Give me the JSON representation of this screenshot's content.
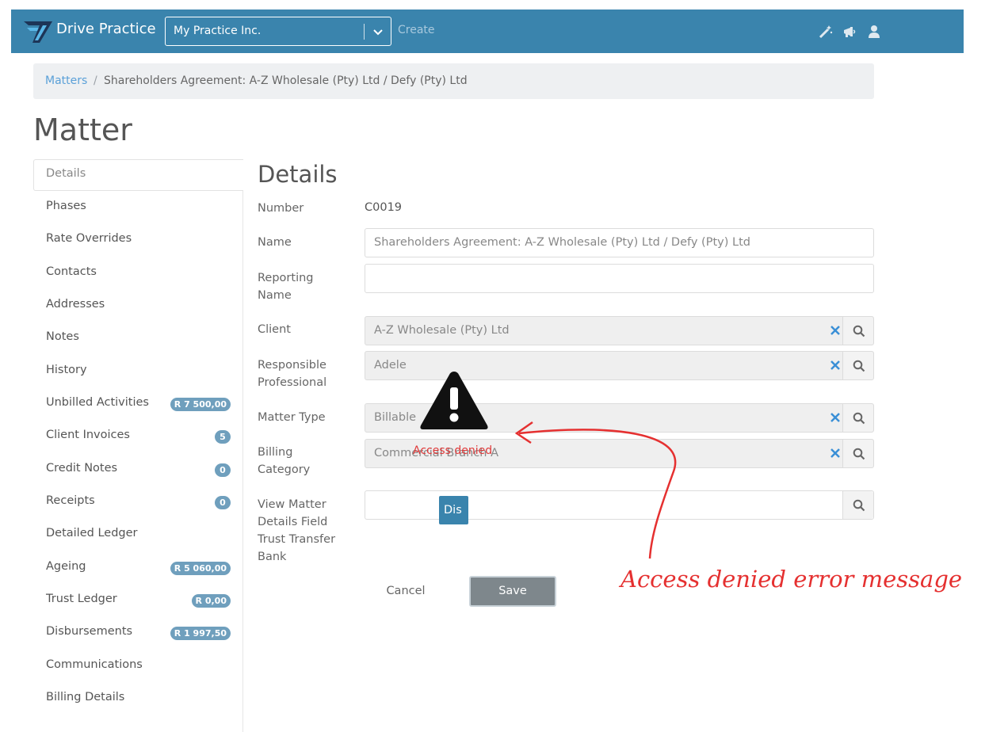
{
  "header": {
    "brand": "Drive Practice",
    "practice_selected": "My Practice Inc.",
    "create_label": "Create",
    "icons": [
      "magic-wand-icon",
      "megaphone-icon",
      "user-icon"
    ],
    "color": "#3a84ad"
  },
  "breadcrumb": {
    "link": "Matters",
    "separator": "/",
    "current": "Shareholders Agreement: A-Z Wholesale (Pty) Ltd / Defy (Pty) Ltd"
  },
  "page": {
    "title": "Matter"
  },
  "sidebar": {
    "items": [
      {
        "label": "Details",
        "active": true
      },
      {
        "label": "Phases"
      },
      {
        "label": "Rate Overrides"
      },
      {
        "label": "Contacts"
      },
      {
        "label": "Addresses"
      },
      {
        "label": "Notes"
      },
      {
        "label": "History"
      },
      {
        "label": "Unbilled Activities",
        "badge": "R 7 500,00"
      },
      {
        "label": "Client Invoices",
        "badge": "5"
      },
      {
        "label": "Credit Notes",
        "badge": "0"
      },
      {
        "label": "Receipts",
        "badge": "0"
      },
      {
        "label": "Detailed Ledger"
      },
      {
        "label": "Ageing",
        "badge": "R 5 060,00"
      },
      {
        "label": "Trust Ledger",
        "badge": "R 0,00"
      },
      {
        "label": "Disbursements",
        "badge": "R 1 997,50"
      },
      {
        "label": "Communications"
      },
      {
        "label": "Billing Details"
      }
    ]
  },
  "details": {
    "title": "Details",
    "number": {
      "label": "Number",
      "value": "C0019"
    },
    "name": {
      "label": "Name",
      "value": "Shareholders Agreement:  A-Z Wholesale (Pty) Ltd / Defy (Pty) Ltd"
    },
    "reporting_name": {
      "label_line1": "Reporting",
      "label_line2": "Name",
      "value": ""
    },
    "client": {
      "label": "Client",
      "value": "A-Z Wholesale (Pty) Ltd"
    },
    "responsible_professional": {
      "label_line1": "Responsible",
      "label_line2": "Professional",
      "value": "Adele"
    },
    "matter_type": {
      "label": "Matter Type",
      "value": "Billable"
    },
    "billing_category": {
      "label_line1": "Billing",
      "label_line2": "Category",
      "value": "Commercial Branch A"
    },
    "trust_transfer_bank": {
      "label_line1": "View Matter",
      "label_line2": "Details Field",
      "label_line3": "Trust Transfer",
      "label_line4": "Bank",
      "button_label": "Dis"
    },
    "cancel_label": "Cancel",
    "save_label": "Save"
  },
  "overlay": {
    "error_text": "Access denied",
    "annotation": "Access denied error message",
    "annotation_color": "#e53030"
  }
}
